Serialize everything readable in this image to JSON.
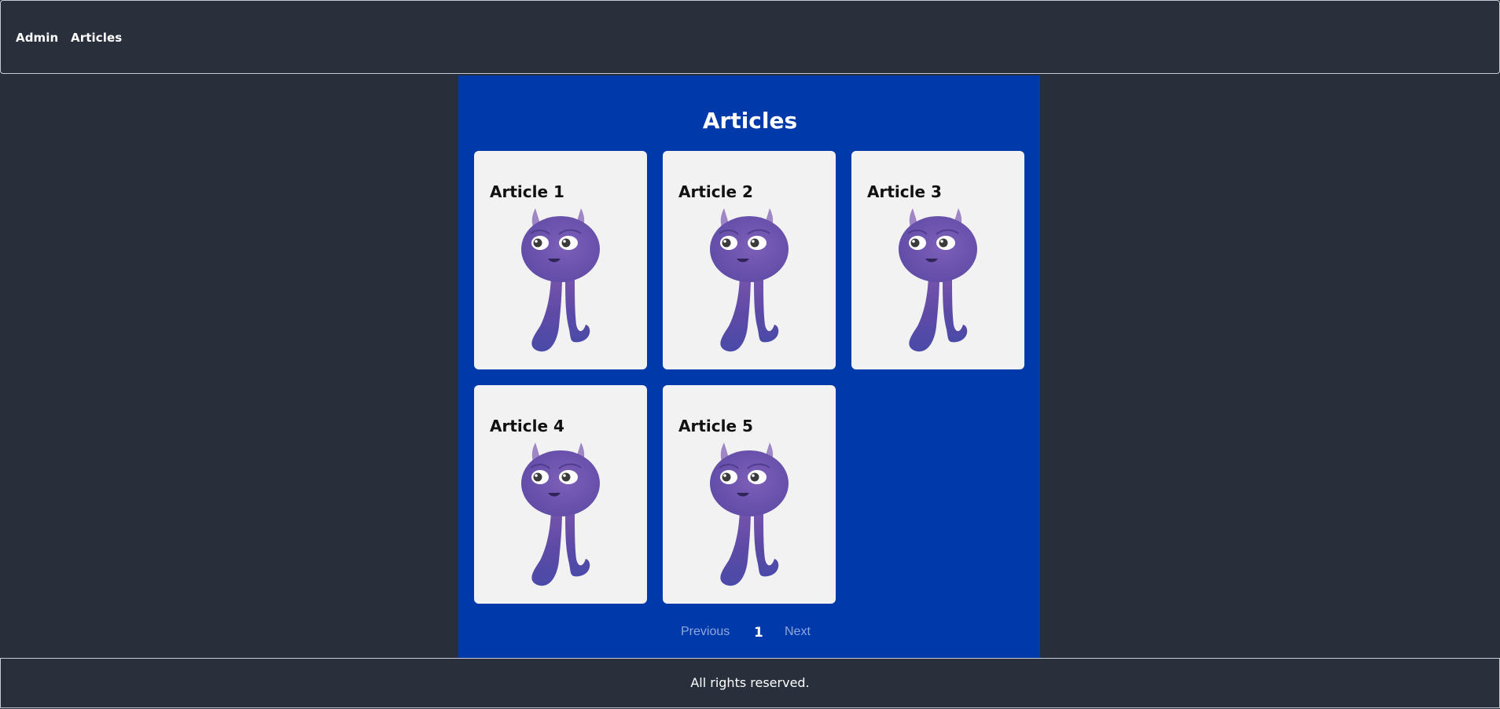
{
  "nav": {
    "items": [
      {
        "label": "Admin"
      },
      {
        "label": "Articles"
      }
    ]
  },
  "main": {
    "title": "Articles",
    "background": "#0039a9",
    "articles": [
      {
        "title": "Article 1",
        "image_icon": "purple-monster-icon"
      },
      {
        "title": "Article 2",
        "image_icon": "purple-monster-icon"
      },
      {
        "title": "Article 3",
        "image_icon": "purple-monster-icon"
      },
      {
        "title": "Article 4",
        "image_icon": "purple-monster-icon"
      },
      {
        "title": "Article 5",
        "image_icon": "purple-monster-icon"
      }
    ]
  },
  "pagination": {
    "previous_label": "Previous",
    "current_page": "1",
    "next_label": "Next"
  },
  "footer": {
    "text": "All rights reserved."
  },
  "colors": {
    "page_background": "#282f3b",
    "panel_background": "#0039a9",
    "card_background": "#f2f2f2",
    "link_muted": "#8ea7de"
  }
}
